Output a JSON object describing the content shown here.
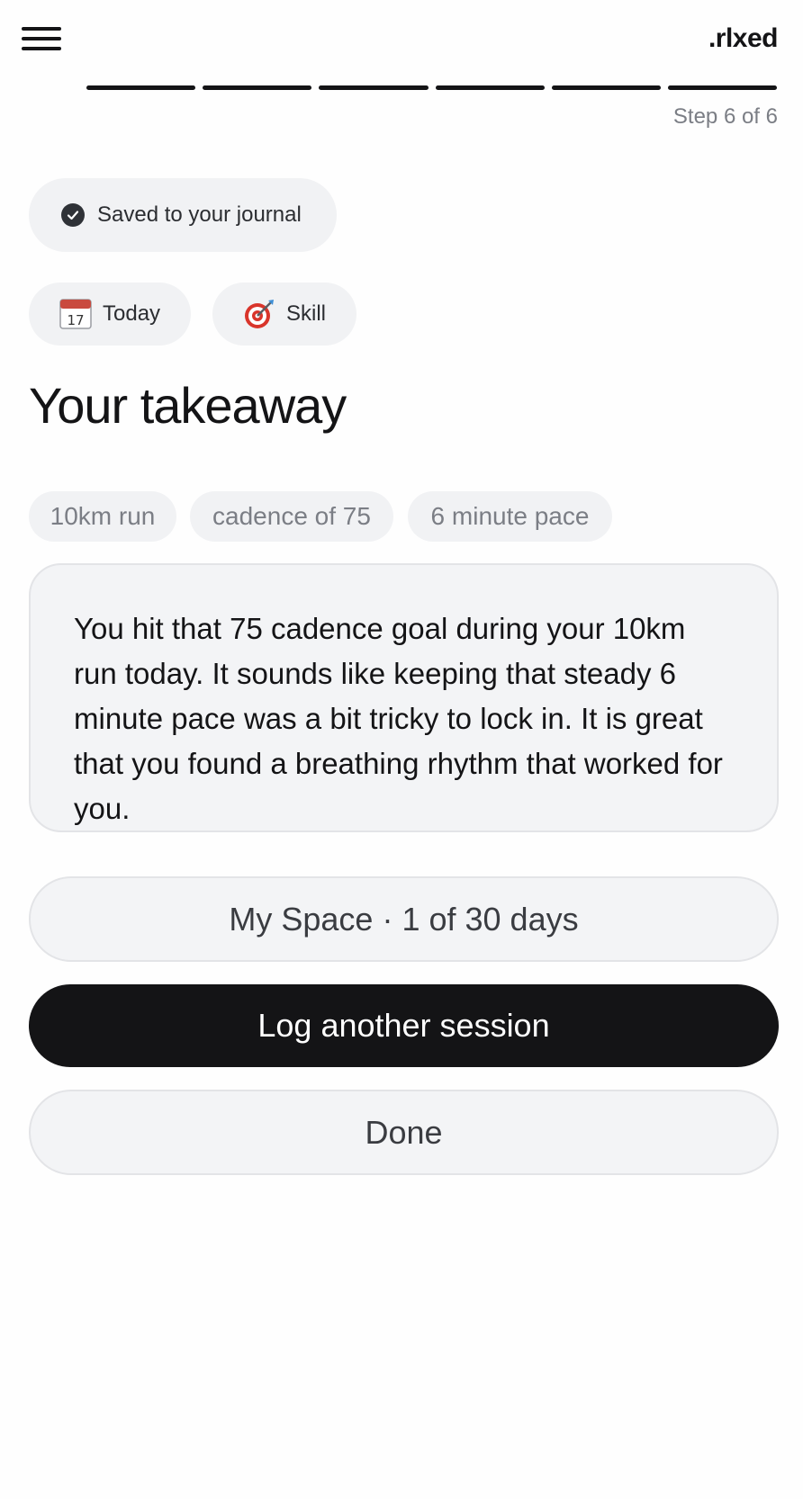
{
  "header": {
    "menu_icon": "hamburger-menu-icon",
    "logo": ".rlxed"
  },
  "progress": {
    "total_steps": 6,
    "completed_steps": 6,
    "label": "Step 6 of 6"
  },
  "status": {
    "icon": "check-circle-icon",
    "text": "Saved to your journal"
  },
  "tags": [
    {
      "icon": "calendar-icon",
      "label": "Today"
    },
    {
      "icon": "target-icon",
      "label": "Skill"
    }
  ],
  "page_title": "Your takeaway",
  "keywords": [
    "10km run",
    "cadence of 75",
    "6 minute pace"
  ],
  "takeaway": {
    "text": "You hit that 75 cadence goal during your 10km run today. It sounds like keeping that steady 6 minute pace was a bit tricky to lock in. It is great that you found a breathing rhythm that worked for you."
  },
  "actions": {
    "space_label": "My Space · 1 of 30 days",
    "log_label": "Log another session",
    "done_label": "Done"
  },
  "colors": {
    "primary": "#141416",
    "surface": "#f1f2f4",
    "muted_text": "#7b7e85"
  }
}
